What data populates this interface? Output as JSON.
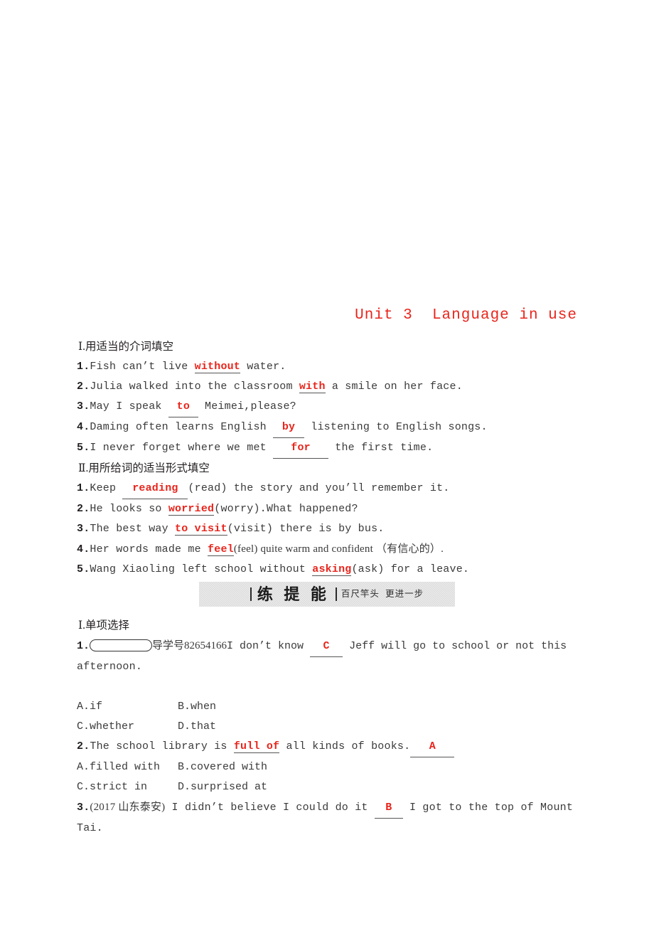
{
  "title": "Unit 3  Language in use",
  "title_color": "#e8251c",
  "section_1": {
    "heading": "Ⅰ.用适当的介词填空",
    "items": [
      {
        "num": "1.",
        "before": "Fish can’t live ",
        "answer": "without",
        "answer_style": "tight",
        "after": " water."
      },
      {
        "num": "2.",
        "before": "Julia walked into the classroom ",
        "answer": "with",
        "answer_style": "tight",
        "after": " a smile on her face."
      },
      {
        "num": "3.",
        "before": "May I speak ",
        "answer": "to",
        "answer_style": "blank",
        "after": " Meimei,please?"
      },
      {
        "num": "4.",
        "before": "Daming often learns English ",
        "answer": "by",
        "answer_style": "blank",
        "after": " listening to English songs."
      },
      {
        "num": "5.",
        "before": "I never forget where we met ",
        "answer": "for",
        "answer_style": "blank",
        "after": " the first time."
      }
    ]
  },
  "section_2": {
    "heading": "Ⅱ.用所给词的适当形式填空",
    "items": [
      {
        "num": "1.",
        "before": "Keep ",
        "answer": "reading",
        "answer_style": "blank",
        "after": "(read) the story and you’ll remember it."
      },
      {
        "num": "2.",
        "before": "He looks so ",
        "answer": "worried",
        "answer_style": "tight",
        "after": "(worry).What happened?"
      },
      {
        "num": "3.",
        "before": "The best way ",
        "answer": "to visit",
        "answer_style": "tight",
        "after": "(visit) there is by bus."
      },
      {
        "num": "4.",
        "before": "Her words made me ",
        "answer": "feel",
        "answer_style": "tight",
        "after": "(feel) quite warm and confident （有信心的）."
      },
      {
        "num": "5.",
        "before": "Wang Xiaoling left school without ",
        "answer": "asking",
        "answer_style": "tight",
        "after": "(ask) for a leave."
      }
    ]
  },
  "banner": {
    "main": "练 提 能",
    "sub": "百尺竿头  更进一步"
  },
  "section_3": {
    "heading": "Ⅰ.单项选择",
    "questions": [
      {
        "num": "1.",
        "code_label": "导学号",
        "code_number": "82654166",
        "stem_before": "I don’t know ",
        "answer": "C",
        "stem_after": " Jeff will go to school or not this",
        "stem_wrap": "afternoon.",
        "options": [
          {
            "key": "A.",
            "text": "if"
          },
          {
            "key": "B.",
            "text": "when"
          },
          {
            "key": "C.",
            "text": "whether"
          },
          {
            "key": "D.",
            "text": "that"
          }
        ]
      },
      {
        "num": "2.",
        "stem_before": "The school library is ",
        "underlined_phrase": "full of",
        "stem_middle": " all kinds of books.",
        "answer": "A",
        "options": [
          {
            "key": "A.",
            "text": "filled with"
          },
          {
            "key": "B.",
            "text": "covered with"
          },
          {
            "key": "C.",
            "text": "strict in"
          },
          {
            "key": "D.",
            "text": "surprised at"
          }
        ]
      },
      {
        "num": "3.",
        "source": "(2017 山东泰安)",
        "stem_before": " I didn’t believe I could do it ",
        "answer": "B",
        "stem_after": " I got to the top of Mount",
        "stem_wrap": "Tai."
      }
    ]
  }
}
